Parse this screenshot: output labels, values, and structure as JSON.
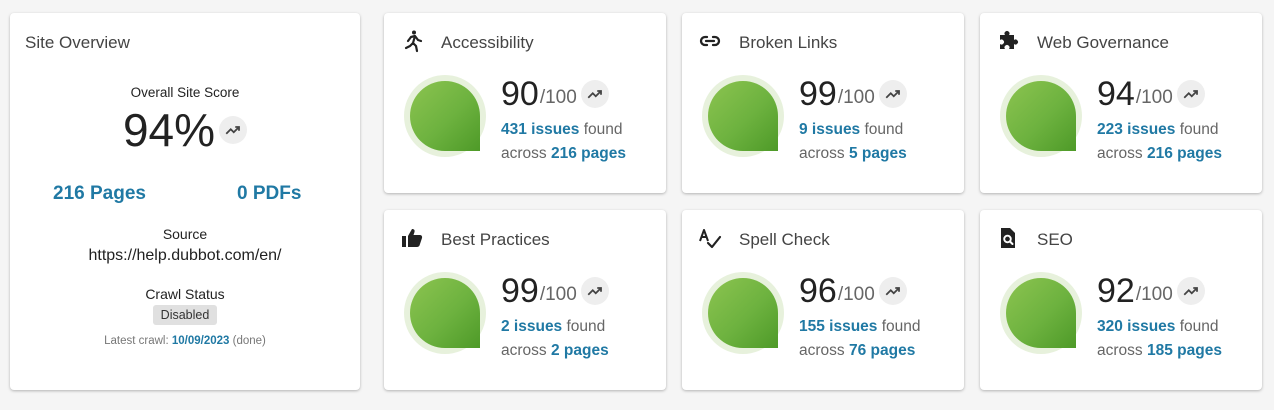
{
  "overview": {
    "title": "Site Overview",
    "score_label": "Overall Site Score",
    "score": "94%",
    "pages": "216 Pages",
    "pdfs": "0 PDFs",
    "source_label": "Source",
    "source_url": "https://help.dubbot.com/en/",
    "crawl_status_label": "Crawl Status",
    "crawl_status": "Disabled",
    "latest_crawl_prefix": "Latest crawl:",
    "latest_crawl_date": "10/09/2023",
    "latest_crawl_suffix": "(done)"
  },
  "common": {
    "max": "/100",
    "issues_found": "found",
    "across": "across"
  },
  "metrics": [
    {
      "title": "Accessibility",
      "icon": "person-walking-icon",
      "score": "90",
      "issues": "431 issues",
      "pages": "216 pages"
    },
    {
      "title": "Broken Links",
      "icon": "link-icon",
      "score": "99",
      "issues": "9 issues",
      "pages": "5 pages"
    },
    {
      "title": "Web Governance",
      "icon": "puzzle-icon",
      "score": "94",
      "issues": "223 issues",
      "pages": "216 pages"
    },
    {
      "title": "Best Practices",
      "icon": "thumbs-up-icon",
      "score": "99",
      "issues": "2 issues",
      "pages": "2 pages"
    },
    {
      "title": "Spell Check",
      "icon": "spellcheck-icon",
      "score": "96",
      "issues": "155 issues",
      "pages": "76 pages"
    },
    {
      "title": "SEO",
      "icon": "seo-search-icon",
      "score": "92",
      "issues": "320 issues",
      "pages": "185 pages"
    }
  ],
  "colors": {
    "accent": "#2079a4",
    "score_green": "#6db23f"
  }
}
